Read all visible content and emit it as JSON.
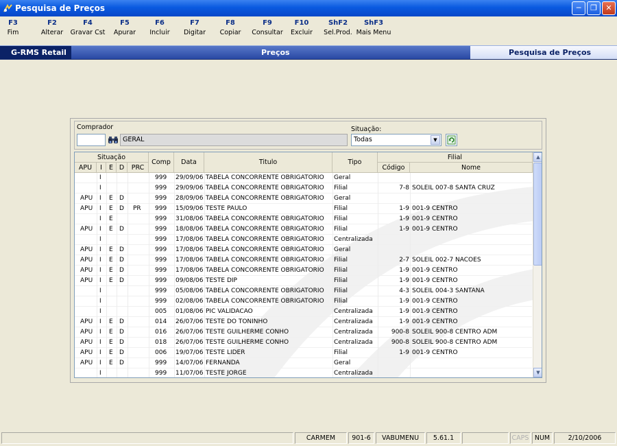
{
  "window": {
    "title": "Pesquisa de Preços"
  },
  "fkeys": [
    {
      "key": "F3",
      "label": "Fim"
    },
    {
      "key": "F2",
      "label": "Alterar"
    },
    {
      "key": "F4",
      "label": "Gravar Cst"
    },
    {
      "key": "F5",
      "label": "Apurar"
    },
    {
      "key": "F6",
      "label": "Incluir"
    },
    {
      "key": "F7",
      "label": "Digitar"
    },
    {
      "key": "F8",
      "label": "Copiar"
    },
    {
      "key": "F9",
      "label": "Consultar"
    },
    {
      "key": "F10",
      "label": "Excluir"
    },
    {
      "key": "ShF2",
      "label": "Sel.Prod."
    },
    {
      "key": "ShF3",
      "label": "Mais Menu"
    }
  ],
  "menubar": {
    "brand": "G-RMS Retail",
    "section": "Preços",
    "screen": "Pesquisa de Preços"
  },
  "filters": {
    "buyer_label": "Comprador",
    "buyer_code": "",
    "buyer_name": "GERAL",
    "situation_label": "Situação:",
    "situation_value": "Todas"
  },
  "grid": {
    "group_headers": {
      "situacao": "Situação",
      "filial": "Filial"
    },
    "headers": {
      "apu": "APU",
      "i": "I",
      "e": "E",
      "d": "D",
      "prc": "PRC",
      "comp": "Comp",
      "data": "Data",
      "titulo": "Titulo",
      "tipo": "Tipo",
      "codigo": "Código",
      "nome": "Nome"
    },
    "rows": [
      {
        "apu": "",
        "i": "I",
        "e": "",
        "d": "",
        "prc": "",
        "comp": "999",
        "data": "29/09/06",
        "titulo": "TABELA CONCORRENTE OBRIGATORIO",
        "tipo": "Geral",
        "codigo": "",
        "nome": ""
      },
      {
        "apu": "",
        "i": "I",
        "e": "",
        "d": "",
        "prc": "",
        "comp": "999",
        "data": "29/09/06",
        "titulo": "TABELA CONCORRENTE OBRIGATORIO",
        "tipo": "Filial",
        "codigo": "7-8",
        "nome": "SOLEIL 007-8 SANTA CRUZ"
      },
      {
        "apu": "APU",
        "i": "I",
        "e": "E",
        "d": "D",
        "prc": "",
        "comp": "999",
        "data": "28/09/06",
        "titulo": "TABELA CONCORRENTE OBRIGATORIO",
        "tipo": "Geral",
        "codigo": "",
        "nome": ""
      },
      {
        "apu": "APU",
        "i": "I",
        "e": "E",
        "d": "D",
        "prc": "PR",
        "comp": "999",
        "data": "15/09/06",
        "titulo": "TESTE PAULO",
        "tipo": "Filial",
        "codigo": "1-9",
        "nome": "001-9 CENTRO"
      },
      {
        "apu": "",
        "i": "I",
        "e": "E",
        "d": "",
        "prc": "",
        "comp": "999",
        "data": "31/08/06",
        "titulo": "TABELA CONCORRENTE OBRIGATORIO",
        "tipo": "Filial",
        "codigo": "1-9",
        "nome": "001-9 CENTRO"
      },
      {
        "apu": "APU",
        "i": "I",
        "e": "E",
        "d": "D",
        "prc": "",
        "comp": "999",
        "data": "18/08/06",
        "titulo": "TABELA CONCORRENTE OBRIGATORIO",
        "tipo": "Filial",
        "codigo": "1-9",
        "nome": "001-9 CENTRO"
      },
      {
        "apu": "",
        "i": "I",
        "e": "",
        "d": "",
        "prc": "",
        "comp": "999",
        "data": "17/08/06",
        "titulo": "TABELA CONCORRENTE OBRIGATORIO",
        "tipo": "Centralizada",
        "codigo": "",
        "nome": ""
      },
      {
        "apu": "APU",
        "i": "I",
        "e": "E",
        "d": "D",
        "prc": "",
        "comp": "999",
        "data": "17/08/06",
        "titulo": "TABELA CONCORRENTE OBRIGATORIO",
        "tipo": "Geral",
        "codigo": "",
        "nome": ""
      },
      {
        "apu": "APU",
        "i": "I",
        "e": "E",
        "d": "D",
        "prc": "",
        "comp": "999",
        "data": "17/08/06",
        "titulo": "TABELA CONCORRENTE OBRIGATORIO",
        "tipo": "Filial",
        "codigo": "2-7",
        "nome": "SOLEIL 002-7 NACOES"
      },
      {
        "apu": "APU",
        "i": "I",
        "e": "E",
        "d": "D",
        "prc": "",
        "comp": "999",
        "data": "17/08/06",
        "titulo": "TABELA CONCORRENTE OBRIGATORIO",
        "tipo": "Filial",
        "codigo": "1-9",
        "nome": "001-9 CENTRO"
      },
      {
        "apu": "APU",
        "i": "I",
        "e": "E",
        "d": "D",
        "prc": "",
        "comp": "999",
        "data": "09/08/06",
        "titulo": "TESTE DIP",
        "tipo": "Filial",
        "codigo": "1-9",
        "nome": "001-9 CENTRO"
      },
      {
        "apu": "",
        "i": "I",
        "e": "",
        "d": "",
        "prc": "",
        "comp": "999",
        "data": "05/08/06",
        "titulo": "TABELA CONCORRENTE OBRIGATORIO",
        "tipo": "Filial",
        "codigo": "4-3",
        "nome": "SOLEIL 004-3 SANTANA"
      },
      {
        "apu": "",
        "i": "I",
        "e": "",
        "d": "",
        "prc": "",
        "comp": "999",
        "data": "02/08/06",
        "titulo": "TABELA CONCORRENTE OBRIGATORIO",
        "tipo": "Filial",
        "codigo": "1-9",
        "nome": "001-9 CENTRO"
      },
      {
        "apu": "",
        "i": "I",
        "e": "",
        "d": "",
        "prc": "",
        "comp": "005",
        "data": "01/08/06",
        "titulo": "PIC VALIDACAO",
        "tipo": "Centralizada",
        "codigo": "1-9",
        "nome": "001-9 CENTRO"
      },
      {
        "apu": "APU",
        "i": "I",
        "e": "E",
        "d": "D",
        "prc": "",
        "comp": "014",
        "data": "26/07/06",
        "titulo": "TESTE DO TONINHO",
        "tipo": "Centralizada",
        "codigo": "1-9",
        "nome": "001-9 CENTRO"
      },
      {
        "apu": "APU",
        "i": "I",
        "e": "E",
        "d": "D",
        "prc": "",
        "comp": "016",
        "data": "26/07/06",
        "titulo": "TESTE GUILHERME CONHO",
        "tipo": "Centralizada",
        "codigo": "900-8",
        "nome": "SOLEIL 900-8 CENTRO ADM"
      },
      {
        "apu": "APU",
        "i": "I",
        "e": "E",
        "d": "D",
        "prc": "",
        "comp": "018",
        "data": "26/07/06",
        "titulo": "TESTE GUILHERME CONHO",
        "tipo": "Centralizada",
        "codigo": "900-8",
        "nome": "SOLEIL 900-8 CENTRO ADM"
      },
      {
        "apu": "APU",
        "i": "I",
        "e": "E",
        "d": "D",
        "prc": "",
        "comp": "006",
        "data": "19/07/06",
        "titulo": "TESTE LIDER",
        "tipo": "Filial",
        "codigo": "1-9",
        "nome": "001-9 CENTRO"
      },
      {
        "apu": "APU",
        "i": "I",
        "e": "E",
        "d": "D",
        "prc": "",
        "comp": "999",
        "data": "14/07/06",
        "titulo": "FERNANDA",
        "tipo": "Geral",
        "codigo": "",
        "nome": ""
      },
      {
        "apu": "",
        "i": "I",
        "e": "",
        "d": "",
        "prc": "",
        "comp": "999",
        "data": "11/07/06",
        "titulo": "TESTE JORGE",
        "tipo": "Centralizada",
        "codigo": "",
        "nome": ""
      }
    ]
  },
  "statusbar": {
    "user": "CARMEM",
    "store": "901-6",
    "menu": "VABUMENU",
    "version": "5.61.1",
    "caps": "CAPS",
    "num": "NUM",
    "date": "2/10/2006"
  },
  "colors": {
    "titlebar": "#0a5ae0",
    "menubar": "#2948a3",
    "brand_bg": "#0b2266",
    "fkey_text": "#0b2f88",
    "window_bg": "#ece9d8"
  },
  "icons": {
    "app": "app-icon",
    "minimize": "minimize-icon",
    "maximize": "maximize-icon",
    "close": "close-icon",
    "search": "binoculars-icon",
    "dropdown": "chevron-down-icon",
    "refresh": "refresh-icon",
    "scroll_up": "scroll-up-icon",
    "scroll_down": "scroll-down-icon"
  }
}
